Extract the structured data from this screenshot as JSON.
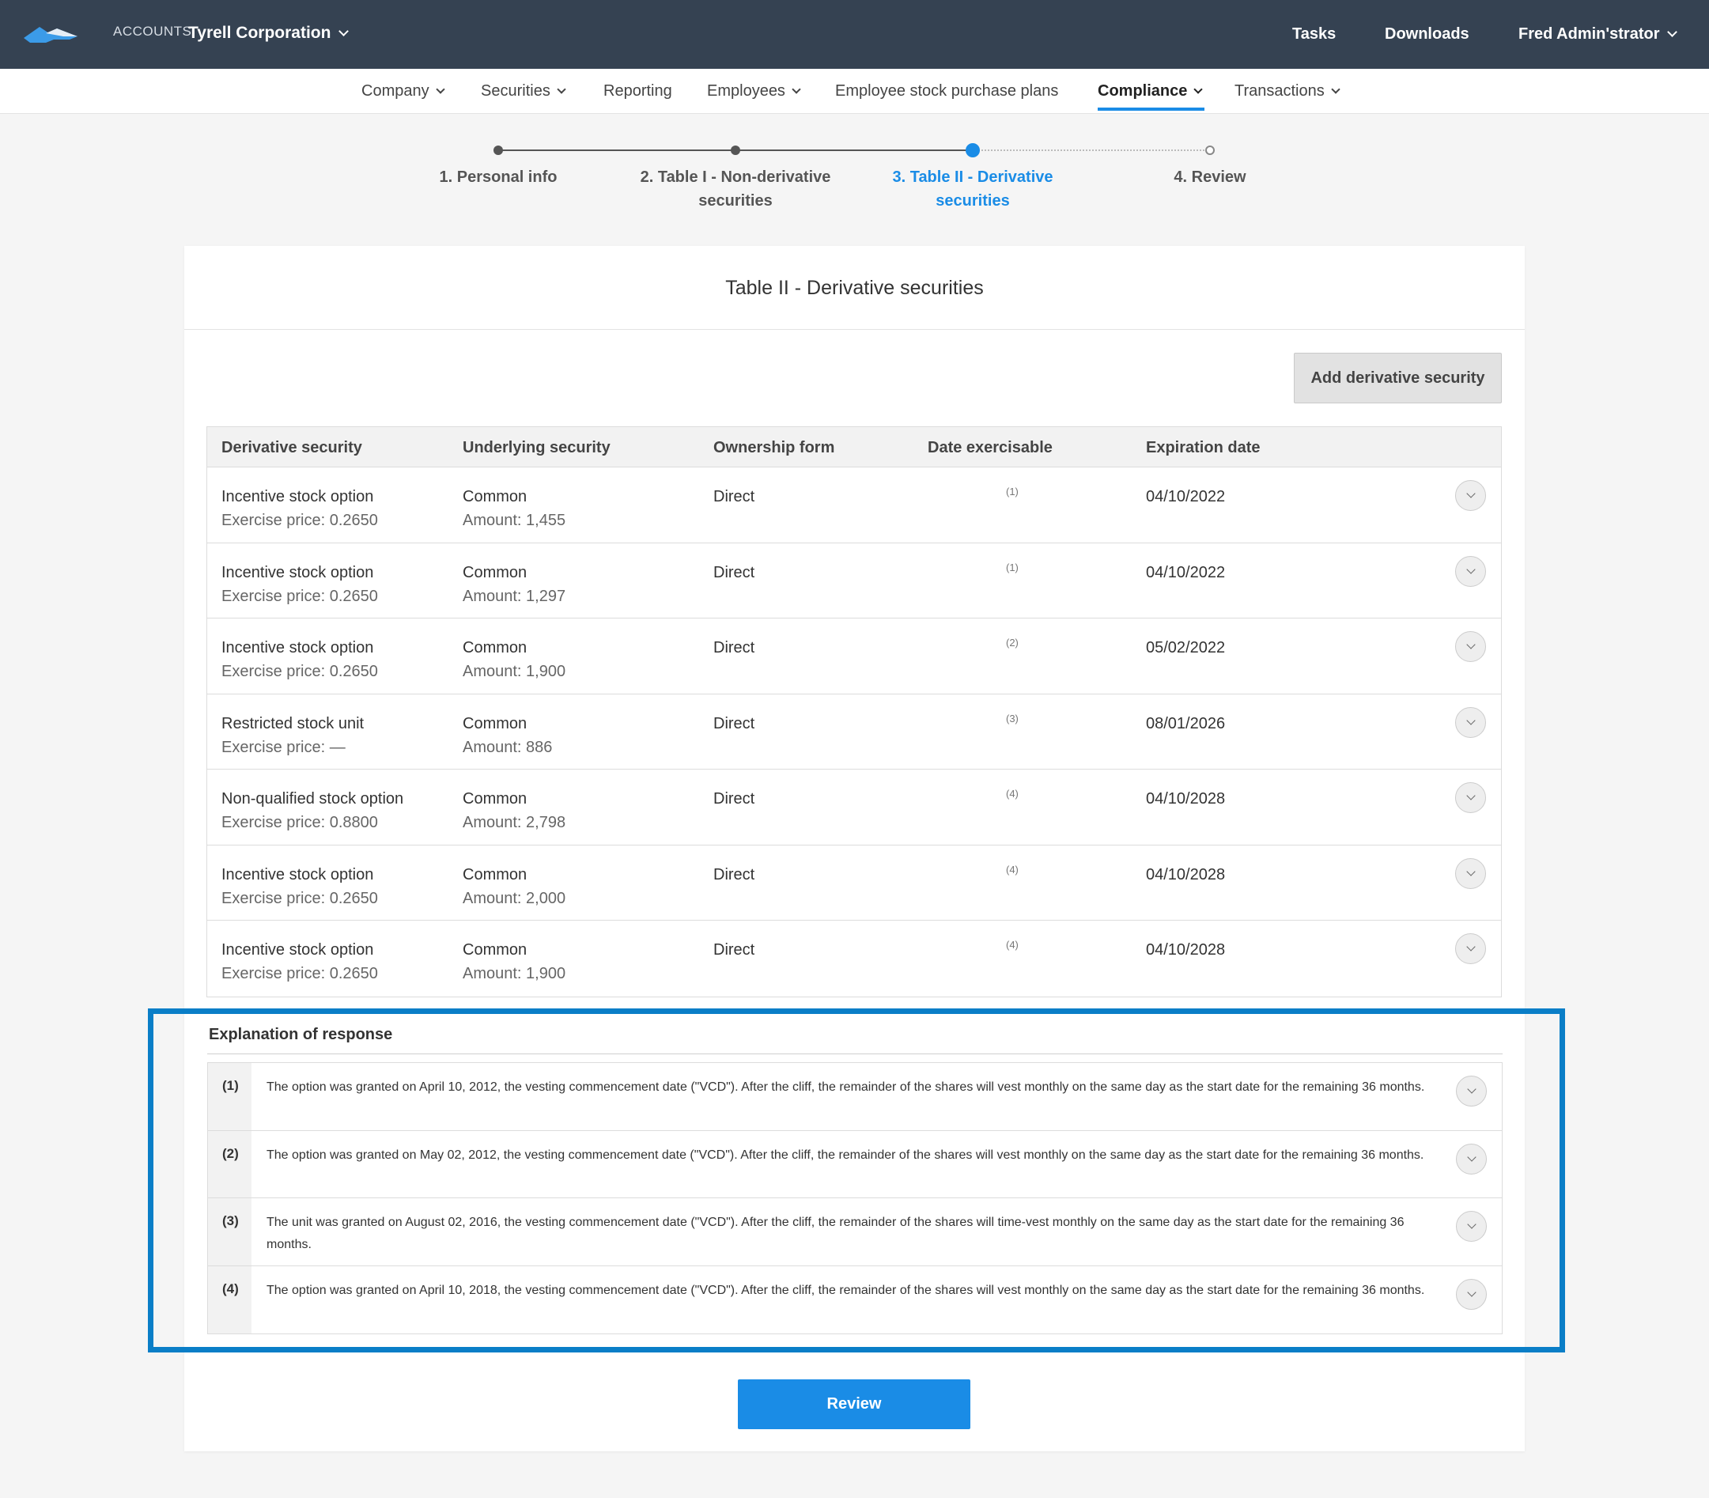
{
  "topbar": {
    "accounts_label": "ACCOUNTS",
    "company": "Tyrell Corporation",
    "links": {
      "tasks": "Tasks",
      "downloads": "Downloads",
      "user": "Fred Admin'strator"
    }
  },
  "nav": {
    "company": "Company",
    "securities": "Securities",
    "reporting": "Reporting",
    "employees": "Employees",
    "espp": "Employee stock purchase plans",
    "compliance": "Compliance",
    "transactions": "Transactions"
  },
  "stepper": {
    "step1": "1. Personal info",
    "step2_line1": "2. Table I - Non-derivative",
    "step2_line2": "securities",
    "step3_line1": "3. Table II - Derivative",
    "step3_line2": "securities",
    "step4": "4. Review"
  },
  "card": {
    "title": "Table II - Derivative securities",
    "add_button": "Add derivative security"
  },
  "table": {
    "headers": {
      "derivative": "Derivative security",
      "underlying": "Underlying security",
      "ownership": "Ownership form",
      "exercisable": "Date exercisable",
      "expiration": "Expiration date"
    },
    "rows": [
      {
        "security": "Incentive stock option",
        "price": "Exercise price: 0.2650",
        "underlying": "Common",
        "amount": "Amount: 1,455",
        "ownership": "Direct",
        "footnote": "(1)",
        "expiration": "04/10/2022"
      },
      {
        "security": "Incentive stock option",
        "price": "Exercise price: 0.2650",
        "underlying": "Common",
        "amount": "Amount: 1,297",
        "ownership": "Direct",
        "footnote": "(1)",
        "expiration": "04/10/2022"
      },
      {
        "security": "Incentive stock option",
        "price": "Exercise price: 0.2650",
        "underlying": "Common",
        "amount": "Amount: 1,900",
        "ownership": "Direct",
        "footnote": "(2)",
        "expiration": "05/02/2022"
      },
      {
        "security": "Restricted stock unit",
        "price": "Exercise price: —",
        "underlying": "Common",
        "amount": "Amount: 886",
        "ownership": "Direct",
        "footnote": "(3)",
        "expiration": "08/01/2026"
      },
      {
        "security": "Non-qualified stock option",
        "price": "Exercise price: 0.8800",
        "underlying": "Common",
        "amount": "Amount: 2,798",
        "ownership": "Direct",
        "footnote": "(4)",
        "expiration": "04/10/2028"
      },
      {
        "security": "Incentive stock option",
        "price": "Exercise price: 0.2650",
        "underlying": "Common",
        "amount": "Amount: 2,000",
        "ownership": "Direct",
        "footnote": "(4)",
        "expiration": "04/10/2028"
      },
      {
        "security": "Incentive stock option",
        "price": "Exercise price: 0.2650",
        "underlying": "Common",
        "amount": "Amount: 1,900",
        "ownership": "Direct",
        "footnote": "(4)",
        "expiration": "04/10/2028"
      }
    ]
  },
  "explanation": {
    "title": "Explanation of response",
    "items": [
      {
        "num": "(1)",
        "text": "The option was granted on April 10, 2012, the vesting commencement date (\"VCD\"). After the cliff, the remainder of the shares will vest monthly on the same day as the start date for the remaining 36 months."
      },
      {
        "num": "(2)",
        "text": "The option was granted on May 02, 2012, the vesting commencement date (\"VCD\"). After the cliff, the remainder of the shares will vest monthly on the same day as the start date for the remaining 36 months."
      },
      {
        "num": "(3)",
        "text": "The unit was granted on August 02, 2016, the vesting commencement date (\"VCD\"). After the cliff, the remainder of the shares will time-vest monthly on the same day as the start date for the remaining 36 months."
      },
      {
        "num": "(4)",
        "text": "The option was granted on April 10, 2018, the vesting commencement date (\"VCD\"). After the cliff, the remainder of the shares will vest monthly on the same day as the start date for the remaining 36 months."
      }
    ]
  },
  "review_button": "Review",
  "colors": {
    "topbar": "#354252",
    "accent": "#1a8ce6",
    "highlight_border": "#0a7ec7"
  },
  "icons": [
    "logo-icon",
    "chevron-down-icon"
  ]
}
